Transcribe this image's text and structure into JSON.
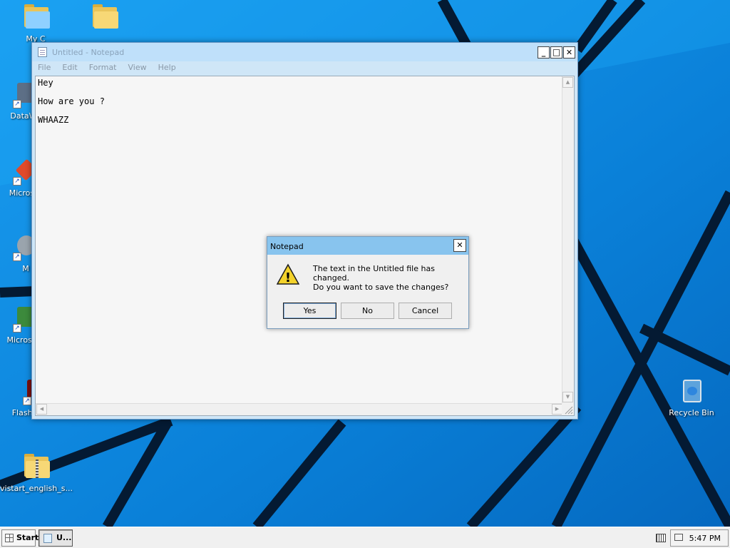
{
  "desktop": {
    "icons": [
      {
        "label": "My C"
      },
      {
        "label": ""
      },
      {
        "label": "DataWa"
      },
      {
        "label": "Micros C"
      },
      {
        "label": "M"
      },
      {
        "label": "Micros Ba"
      },
      {
        "label": "Flash Player"
      },
      {
        "label": "Recycle Bin"
      },
      {
        "label": "vistart_english_s..."
      }
    ]
  },
  "notepad": {
    "title": "Untitled - Notepad",
    "menu": [
      "File",
      "Edit",
      "Format",
      "View",
      "Help"
    ],
    "window_buttons": {
      "minimize": "_",
      "maximize": "□",
      "close": "✕"
    },
    "content_lines": [
      "Hey",
      "How are you ?",
      "WHAAZZ"
    ]
  },
  "dialog": {
    "title": "Notepad",
    "close": "✕",
    "message_line1": "The text in the Untitled file has changed.",
    "message_line2": "Do you want to save the changes?",
    "buttons": {
      "yes": "Yes",
      "no": "No",
      "cancel": "Cancel"
    },
    "warning_glyph": "!"
  },
  "taskbar": {
    "start_label": "Start",
    "task_label": "U...",
    "clock": "5:47 PM"
  },
  "colors": {
    "wallpaper": "#0a7fd6",
    "titlebar_inactive": "#bfe0fa",
    "dialog_title": "#88c4ee"
  }
}
